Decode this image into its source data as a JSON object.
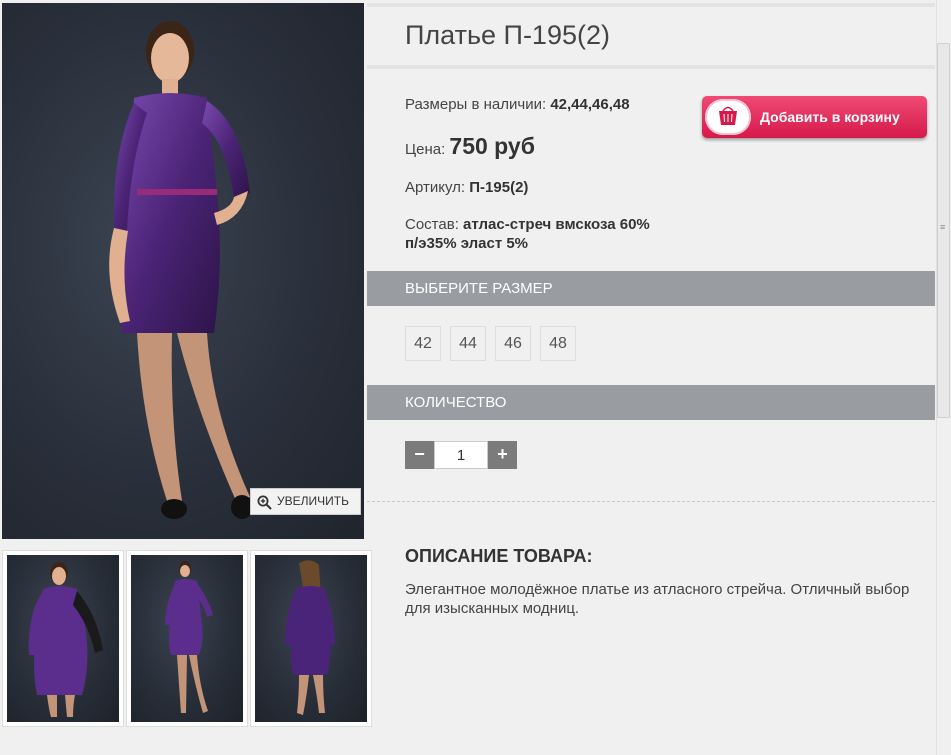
{
  "product": {
    "title": "Платье П-195(2)",
    "sizes_label": "Размеры в наличии:",
    "sizes_value": "42,44,46,48",
    "price_label": "Цена:",
    "price_value": "750 руб",
    "article_label": "Артикул:",
    "article_value": "П-195(2)",
    "composition_label": "Состав:",
    "composition_value_line1": "атлас-стреч вмскоза 60%",
    "composition_value_line2": "п/э35% эласт 5%"
  },
  "gallery": {
    "zoom_label": "УВЕЛИЧИТЬ",
    "thumbnail_count": 3
  },
  "cart": {
    "button_label": "Добавить в корзину",
    "accent_color": "#e2285a"
  },
  "size_select": {
    "header": "ВЫБЕРИТЕ РАЗМЕР",
    "options": [
      "42",
      "44",
      "46",
      "48"
    ]
  },
  "quantity": {
    "header": "КОЛИЧЕСТВО",
    "minus": "−",
    "plus": "+",
    "value": "1"
  },
  "description": {
    "heading": "ОПИСАНИЕ ТОВАРА:",
    "text": "Элегантное молодёжное платье из атласного стрейча. Отличный выбор для изысканных модниц."
  },
  "colors": {
    "section_bar": "#999ca0",
    "dress_purple": "#5a2a8a"
  }
}
